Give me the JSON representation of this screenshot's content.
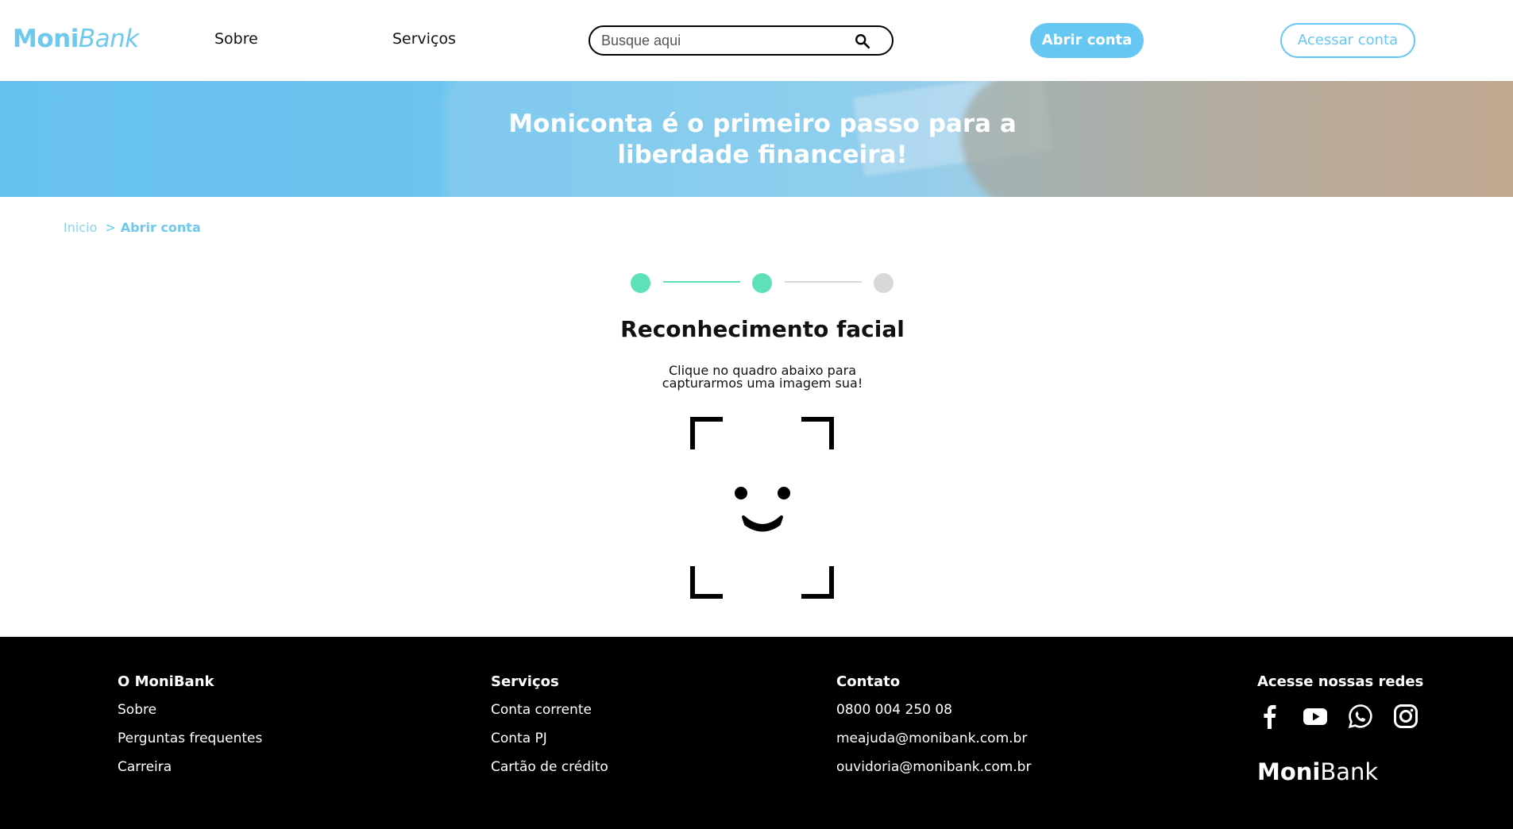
{
  "brand": {
    "part1": "Moni",
    "part2": "Bank"
  },
  "nav": {
    "sobre": "Sobre",
    "servicos": "Serviços"
  },
  "search": {
    "placeholder": "Busque aqui",
    "icon": "search-icon"
  },
  "header_buttons": {
    "open": "Abrir conta",
    "access": "Acessar conta"
  },
  "banner": {
    "title": "Moniconta é o primeiro passo para a liberdade financeira!"
  },
  "breadcrumb": {
    "home": "Inicio",
    "separator": ">",
    "current": "Abrir conta"
  },
  "steps": {
    "total": 3,
    "completed": 2,
    "active_color": "#5ee0b8",
    "inactive_color": "#d8d8d8"
  },
  "main": {
    "title": "Reconhecimento facial",
    "instruction_line1": "Clique no quadro abaixo para",
    "instruction_line2": "capturarmos uma imagem sua!",
    "capture_icon": "face-capture-icon"
  },
  "footer": {
    "col1": {
      "title": "O MoniBank",
      "links": [
        "Sobre",
        "Perguntas frequentes",
        "Carreira"
      ]
    },
    "col2": {
      "title": "Serviços",
      "links": [
        "Conta corrente",
        "Conta PJ",
        "Cartão de crédito"
      ]
    },
    "col3": {
      "title": "Contato",
      "links": [
        "0800 004 250 08",
        "meajuda@monibank.com.br",
        "ouvidoria@monibank.com.br"
      ]
    },
    "col4": {
      "title": "Acesse nossas redes",
      "icons": [
        "facebook-icon",
        "youtube-icon",
        "whatsapp-icon",
        "instagram-icon"
      ]
    },
    "logo": {
      "part1": "Moni",
      "part2": "Bank"
    }
  },
  "colors": {
    "accent": "#67c7f3",
    "step_green": "#5ee0b8",
    "footer_bg": "#000000"
  }
}
